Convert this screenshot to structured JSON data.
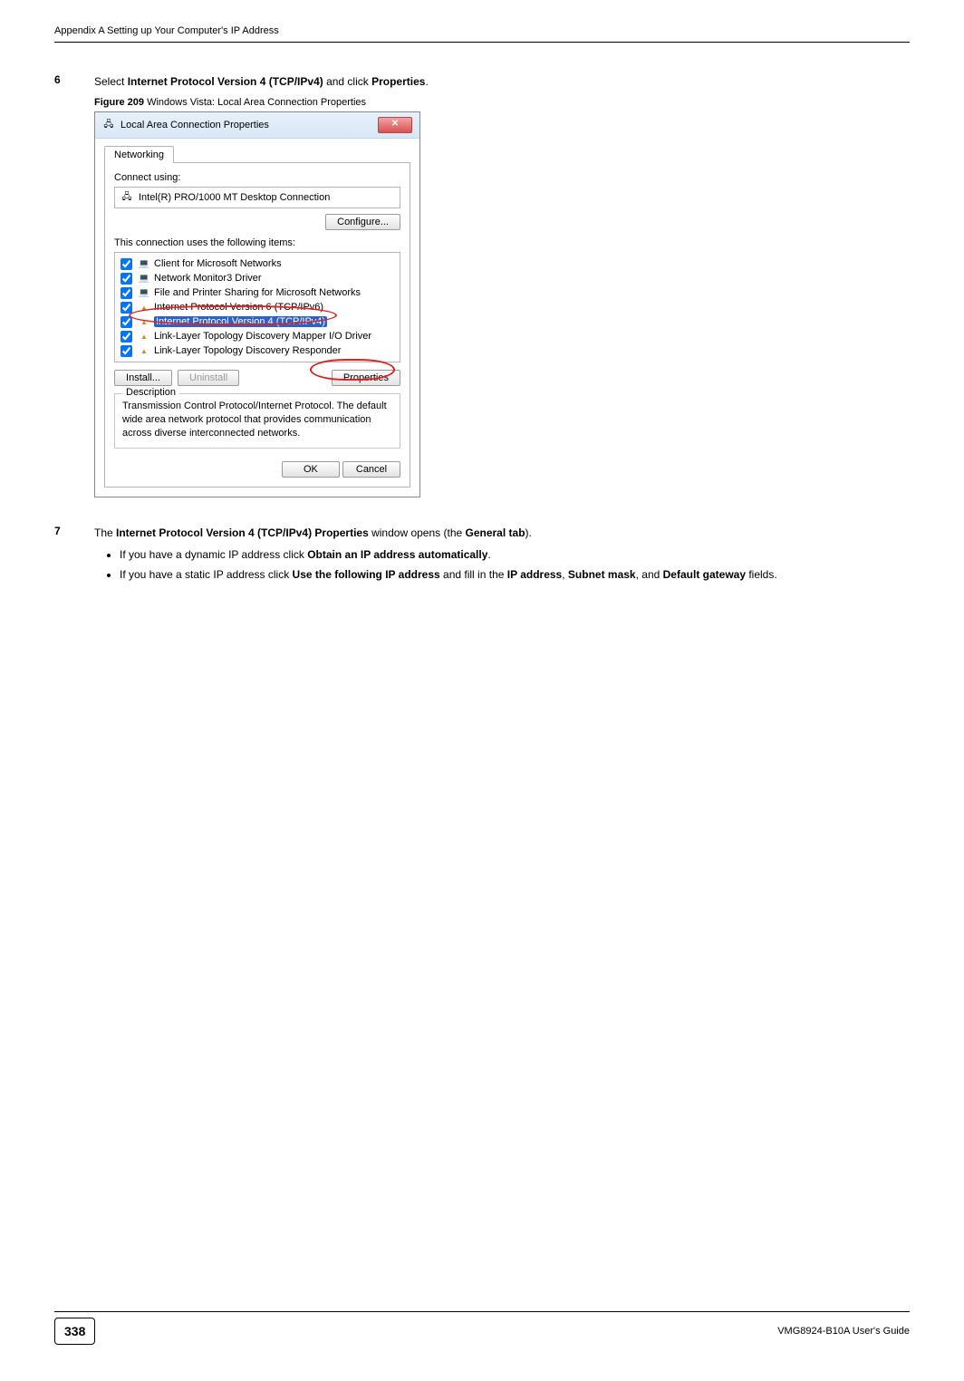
{
  "header": {
    "left": "Appendix A Setting up Your Computer's IP Address",
    "right": ""
  },
  "step6": {
    "num": "6",
    "pre": "Select ",
    "bold1": "Internet Protocol Version 4 (TCP/IPv4)",
    "mid": " and click ",
    "bold2": "Properties",
    "post": "."
  },
  "figure": {
    "no": "Figure 209",
    "caption": "   Windows Vista: Local Area Connection Properties"
  },
  "dialog": {
    "title": "Local Area Connection Properties",
    "tab": "Networking",
    "connectUsingLabel": "Connect using:",
    "adapter": "Intel(R) PRO/1000 MT Desktop Connection",
    "configureBtn": "Configure...",
    "itemsLabel": "This connection uses the following items:",
    "items": [
      {
        "label": "Client for Microsoft Networks",
        "icon": "net"
      },
      {
        "label": "Network Monitor3 Driver",
        "icon": "net"
      },
      {
        "label": "File and Printer Sharing for Microsoft Networks",
        "icon": "net"
      },
      {
        "label": "Internet Protocol Version 6 (TCP/IPv6)",
        "icon": "proto"
      },
      {
        "label": "Internet Protocol Version 4 (TCP/IPv4)",
        "icon": "proto",
        "selected": true
      },
      {
        "label": "Link-Layer Topology Discovery Mapper I/O Driver",
        "icon": "proto"
      },
      {
        "label": "Link-Layer Topology Discovery Responder",
        "icon": "proto"
      }
    ],
    "installBtn": "Install...",
    "uninstallBtn": "Uninstall",
    "propertiesBtn": "Properties",
    "descTitle": "Description",
    "descText": "Transmission Control Protocol/Internet Protocol. The default wide area network protocol that provides communication across diverse interconnected networks.",
    "okBtn": "OK",
    "cancelBtn": "Cancel"
  },
  "step7": {
    "num": "7",
    "pre": "The ",
    "b1": "Internet Protocol Version 4 (TCP/IPv4) Properties",
    "mid1": " window opens (the ",
    "b2": "General tab",
    "post": ")."
  },
  "bullet1": {
    "pre": "If you have a dynamic IP address click ",
    "b": "Obtain an IP address automatically",
    "post": "."
  },
  "bullet2": {
    "pre": "If you have a static IP address click ",
    "b1": "Use the following IP address",
    "mid1": " and fill in the ",
    "b2": "IP address",
    "mid2": ", ",
    "b3": "Subnet mask",
    "mid3": ", and ",
    "b4": "Default gateway",
    "post": " fields."
  },
  "footer": {
    "page": "338",
    "guide": "VMG8924-B10A User's Guide"
  }
}
